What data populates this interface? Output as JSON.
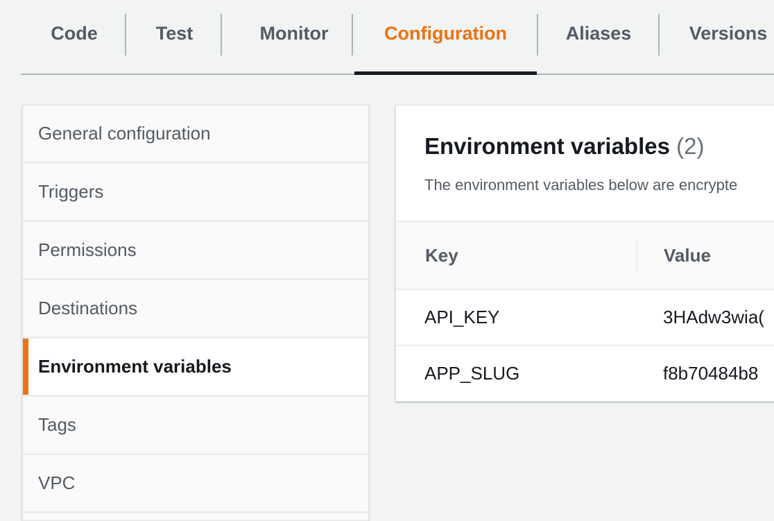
{
  "tabs": [
    {
      "label": "Code"
    },
    {
      "label": "Test"
    },
    {
      "label": "Monitor"
    },
    {
      "label": "Configuration"
    },
    {
      "label": "Aliases"
    },
    {
      "label": "Versions"
    }
  ],
  "active_tab": "Configuration",
  "sidebar": {
    "items": [
      {
        "label": "General configuration"
      },
      {
        "label": "Triggers"
      },
      {
        "label": "Permissions"
      },
      {
        "label": "Destinations"
      },
      {
        "label": "Environment variables"
      },
      {
        "label": "Tags"
      },
      {
        "label": "VPC"
      }
    ],
    "active_item": "Environment variables"
  },
  "env_panel": {
    "title": "Environment variables",
    "count": "(2)",
    "description": "The environment variables below are encrypte",
    "columns": {
      "key": "Key",
      "value": "Value"
    },
    "rows": [
      {
        "key": "API_KEY",
        "value": "3HAdw3wia("
      },
      {
        "key": "APP_SLUG",
        "value": "f8b70484b8"
      }
    ]
  },
  "colors": {
    "accent": "#ec7211",
    "background": "#f2f3f3",
    "text": "#16191f",
    "muted_text": "#545b64"
  }
}
